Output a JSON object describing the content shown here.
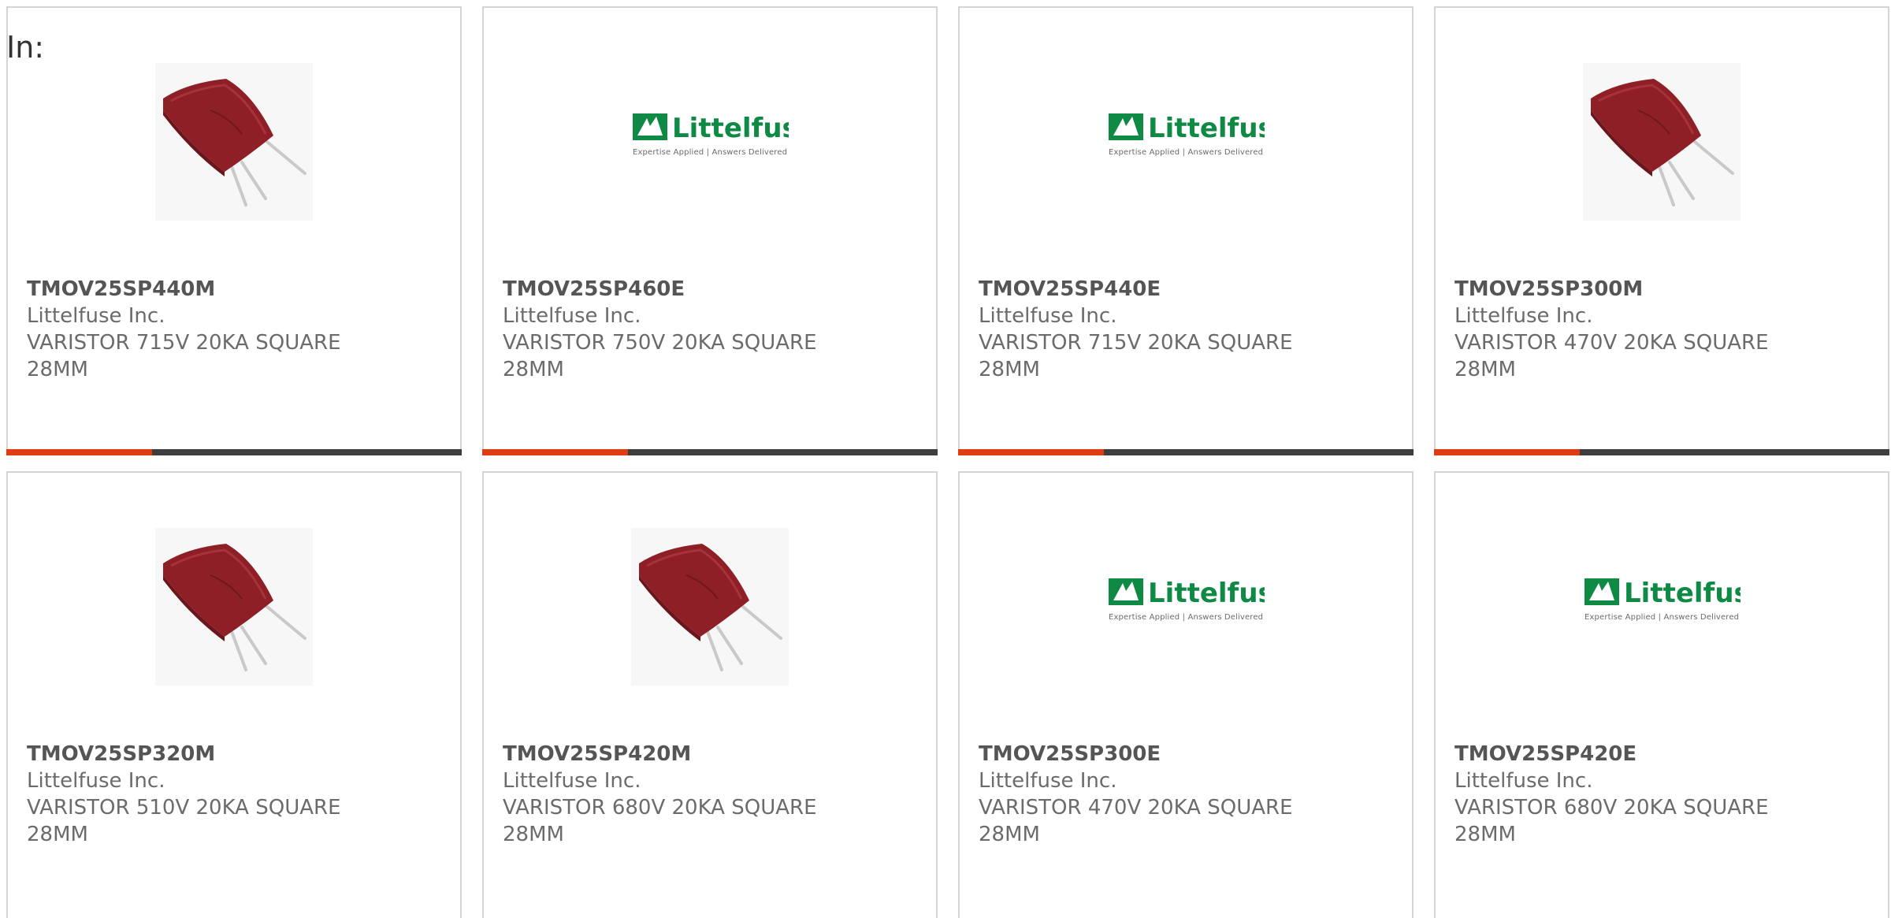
{
  "header": {
    "label": "In:"
  },
  "colors": {
    "accent": "#e03c12",
    "track": "#3d3d3d",
    "brand_green": "#0e8a45",
    "varistor_red": "#8e1f26"
  },
  "products": [
    {
      "part": "TMOV25SP440M",
      "manufacturer": "Littelfuse Inc.",
      "description": "VARISTOR 715V 20KA SQUARE 28MM",
      "image": "varistor-photo",
      "progress": 0.32
    },
    {
      "part": "TMOV25SP460E",
      "manufacturer": "Littelfuse Inc.",
      "description": "VARISTOR 750V 20KA SQUARE 28MM",
      "image": "littelfuse-logo",
      "progress": 0.32
    },
    {
      "part": "TMOV25SP440E",
      "manufacturer": "Littelfuse Inc.",
      "description": "VARISTOR 715V 20KA SQUARE 28MM",
      "image": "littelfuse-logo",
      "progress": 0.32
    },
    {
      "part": "TMOV25SP300M",
      "manufacturer": "Littelfuse Inc.",
      "description": "VARISTOR 470V 20KA SQUARE 28MM",
      "image": "varistor-photo",
      "progress": 0.32
    },
    {
      "part": "TMOV25SP320M",
      "manufacturer": "Littelfuse Inc.",
      "description": "VARISTOR 510V 20KA SQUARE 28MM",
      "image": "varistor-photo"
    },
    {
      "part": "TMOV25SP420M",
      "manufacturer": "Littelfuse Inc.",
      "description": "VARISTOR 680V 20KA SQUARE 28MM",
      "image": "varistor-photo"
    },
    {
      "part": "TMOV25SP300E",
      "manufacturer": "Littelfuse Inc.",
      "description": "VARISTOR 470V 20KA SQUARE 28MM",
      "image": "littelfuse-logo"
    },
    {
      "part": "TMOV25SP420E",
      "manufacturer": "Littelfuse Inc.",
      "description": "VARISTOR 680V 20KA SQUARE 28MM",
      "image": "littelfuse-logo"
    }
  ],
  "logo": {
    "wordmark": "Littelfuse",
    "tagline": "Expertise Applied | Answers Delivered"
  }
}
